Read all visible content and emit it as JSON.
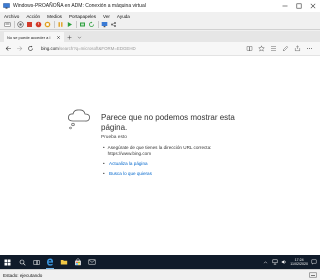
{
  "vm_window": {
    "title": "Windows-PROAÑOÑA en ADM: Conexión a máquina virtual",
    "menu": [
      "Archivo",
      "Acción",
      "Medios",
      "Portapapeles",
      "Ver",
      "Ayuda"
    ],
    "toolbar_icons": [
      "ctrl-alt-del-icon",
      "start-icon",
      "turn-off-icon",
      "shutdown-icon",
      "save-icon",
      "pause-icon",
      "reset-icon",
      "checkpoint-icon",
      "revert-icon",
      "enhanced-session-icon",
      "share-icon"
    ],
    "status": "Estado: ejecutando"
  },
  "browser": {
    "tab_title": "No se puede acceder a l",
    "url_host": "bing.com",
    "url_rest": "/search?q=microsoft&FORM=EDGEHD"
  },
  "error_page": {
    "heading": "Parece que no podemos mostrar esta página.",
    "subtitle": "Prueba esto",
    "suggestion_1": "Asegúrate de que tienes la dirección URL correcta: https://www.bing.com",
    "link_refresh": "Actualiza la página",
    "link_search": "Busca lo que quieras"
  },
  "taskbar": {
    "time": "17:24",
    "date": "11/02/2020"
  },
  "colors": {
    "taskbar_bg": "#101b2a",
    "link": "#0066cc",
    "toolbar_green": "#2e9e3e",
    "toolbar_red": "#d23a2a"
  }
}
